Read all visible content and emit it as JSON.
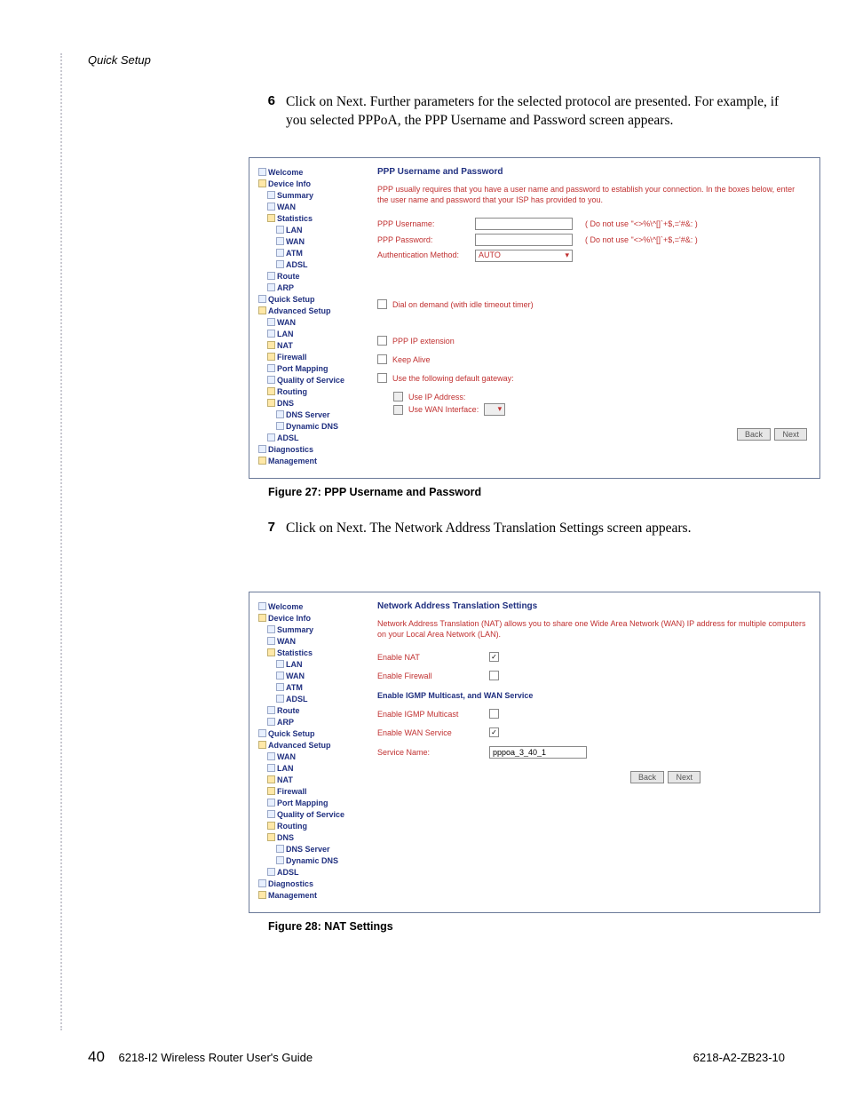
{
  "page": {
    "header_title": "Quick Setup",
    "footer_page": "40",
    "footer_left": "6218-I2 Wireless Router User's Guide",
    "footer_right": "6218-A2-ZB23-10"
  },
  "step6": {
    "num": "6",
    "text": "Click on Next. Further parameters for the selected protocol are presented. For example, if you selected PPPoA, the PPP Username and Password screen appears."
  },
  "step7": {
    "num": "7",
    "text": "Click on Next. The Network Address Translation Settings screen appears."
  },
  "caption27": "Figure 27: PPP Username and Password",
  "caption28": "Figure 28: NAT Settings",
  "tree": {
    "welcome": "Welcome",
    "device_info": "Device Info",
    "summary": "Summary",
    "wan": "WAN",
    "statistics": "Statistics",
    "lan": "LAN",
    "wan2": "WAN",
    "atm": "ATM",
    "adsl": "ADSL",
    "route": "Route",
    "arp": "ARP",
    "quick_setup": "Quick Setup",
    "advanced_setup": "Advanced Setup",
    "wan3": "WAN",
    "lan2": "LAN",
    "nat": "NAT",
    "firewall": "Firewall",
    "port_mapping": "Port Mapping",
    "qos": "Quality of Service",
    "routing": "Routing",
    "dns": "DNS",
    "dns_server": "DNS Server",
    "dynamic_dns": "Dynamic DNS",
    "adsl2": "ADSL",
    "diagnostics": "Diagnostics",
    "management": "Management"
  },
  "shot27": {
    "title": "PPP Username and Password",
    "desc": "PPP usually requires that you have a user name and password to establish your connection. In the boxes below, enter the user name and password that your ISP has provided to you.",
    "lbl_user": "PPP Username:",
    "lbl_pass": "PPP Password:",
    "lbl_auth": "Authentication Method:",
    "auth_value": "AUTO",
    "note1": "( Do not use \"<>%\\^[]`+$,='#&: )",
    "note2": "( Do not use \"<>%\\^[]`+$,='#&: )",
    "chk_dial": "Dial on demand (with idle timeout timer)",
    "chk_ext": "PPP IP extension",
    "chk_keep": "Keep Alive",
    "chk_gw": "Use the following default gateway:",
    "sub_ip": "Use IP Address:",
    "sub_wan": "Use WAN Interface:",
    "btn_back": "Back",
    "btn_next": "Next"
  },
  "shot28": {
    "title": "Network Address Translation Settings",
    "desc": "Network Address Translation (NAT) allows you to share one Wide Area Network (WAN) IP address for multiple computers on your Local Area Network (LAN).",
    "lbl_nat": "Enable NAT",
    "lbl_fw": "Enable Firewall",
    "section": "Enable IGMP Multicast, and WAN Service",
    "lbl_igmp": "Enable IGMP Multicast",
    "lbl_wansvc": "Enable WAN Service",
    "lbl_svcname": "Service Name:",
    "svcname_value": "pppoa_3_40_1",
    "btn_back": "Back",
    "btn_next": "Next"
  }
}
